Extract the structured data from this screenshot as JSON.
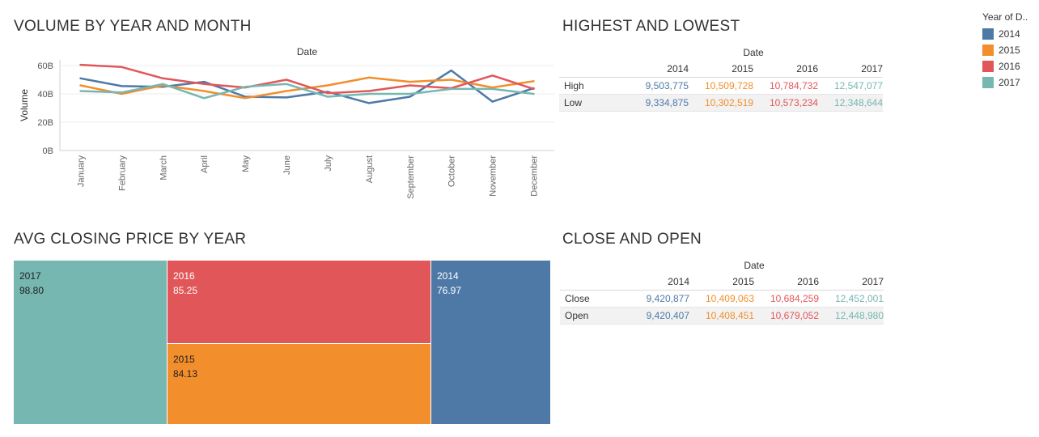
{
  "dashboard": {
    "volume_title": "VOLUME BY YEAR AND MONTH",
    "hilo_title": "HIGHEST AND LOWEST",
    "avg_title": "AVG CLOSING PRICE BY YEAR",
    "closeopen_title": "CLOSE AND OPEN"
  },
  "legend": {
    "title": "Year of D..",
    "items": [
      {
        "label": "2014",
        "color": "#4e79a7"
      },
      {
        "label": "2015",
        "color": "#f28e2b"
      },
      {
        "label": "2016",
        "color": "#e15759"
      },
      {
        "label": "2017",
        "color": "#76b7b2"
      }
    ]
  },
  "chart_data": [
    {
      "type": "line",
      "title": "VOLUME BY YEAR AND MONTH",
      "xlabel": "Date",
      "ylabel": "Volume",
      "ylim": [
        0,
        64
      ],
      "yticks": [
        "0B",
        "20B",
        "40B",
        "60B"
      ],
      "categories": [
        "January",
        "February",
        "March",
        "April",
        "May",
        "June",
        "July",
        "August",
        "September",
        "October",
        "November",
        "December"
      ],
      "series": [
        {
          "name": "2014",
          "color": "#4e79a7",
          "values": [
            51,
            45.5,
            45,
            48.5,
            38,
            37.5,
            41.5,
            33.5,
            38,
            56.5,
            34.5,
            44
          ]
        },
        {
          "name": "2015",
          "color": "#f28e2b",
          "values": [
            46,
            40,
            46,
            42,
            37,
            42,
            46,
            51.5,
            48.5,
            50,
            44.5,
            49
          ]
        },
        {
          "name": "2016",
          "color": "#e15759",
          "values": [
            60.5,
            59,
            51,
            47,
            44.5,
            50,
            40.5,
            42,
            46,
            44,
            53,
            43.5
          ]
        },
        {
          "name": "2017",
          "color": "#76b7b2",
          "values": [
            42,
            41,
            47,
            37,
            45,
            47,
            38,
            40,
            40,
            43.5,
            43.5,
            40
          ]
        }
      ],
      "grid": true
    },
    {
      "type": "table",
      "title": "HIGHEST AND LOWEST",
      "column_header": "Date",
      "columns": [
        "2014",
        "2015",
        "2016",
        "2017"
      ],
      "rows": [
        {
          "label": "High",
          "values": [
            "9,503,775",
            "10,509,728",
            "10,784,732",
            "12,547,077"
          ]
        },
        {
          "label": "Low",
          "values": [
            "9,334,875",
            "10,302,519",
            "10,573,234",
            "12,348,644"
          ]
        }
      ]
    },
    {
      "type": "treemap",
      "title": "AVG CLOSING PRICE BY YEAR",
      "items": [
        {
          "label": "2017",
          "value": "98.80",
          "color": "#76b7b2"
        },
        {
          "label": "2016",
          "value": "85.25",
          "color": "#e15759"
        },
        {
          "label": "2015",
          "value": "84.13",
          "color": "#f28e2b"
        },
        {
          "label": "2014",
          "value": "76.97",
          "color": "#4e79a7"
        }
      ]
    },
    {
      "type": "table",
      "title": "CLOSE AND OPEN",
      "column_header": "Date",
      "columns": [
        "2014",
        "2015",
        "2016",
        "2017"
      ],
      "rows": [
        {
          "label": "Close",
          "values": [
            "9,420,877",
            "10,409,063",
            "10,684,259",
            "12,452,001"
          ]
        },
        {
          "label": "Open",
          "values": [
            "9,420,407",
            "10,408,451",
            "10,679,052",
            "12,448,980"
          ]
        }
      ]
    }
  ]
}
